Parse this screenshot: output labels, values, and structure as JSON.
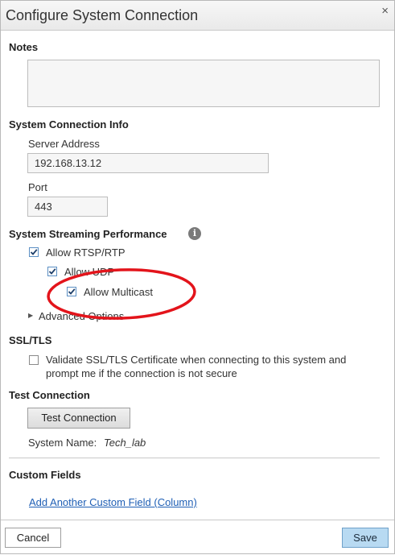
{
  "dialog": {
    "title": "Configure System Connection",
    "close_glyph": "×"
  },
  "notes": {
    "heading": "Notes",
    "value": ""
  },
  "connection_info": {
    "heading": "System Connection Info",
    "server_label": "Server Address",
    "server_value": "192.168.13.12",
    "port_label": "Port",
    "port_value": "443"
  },
  "streaming": {
    "heading": "System Streaming Performance",
    "info_icon": "i",
    "allow_rtsp_label": "Allow RTSP/RTP",
    "allow_rtsp_checked": true,
    "allow_udp_label": "Allow UDP",
    "allow_udp_checked": true,
    "allow_multicast_label": "Allow Multicast",
    "allow_multicast_checked": true,
    "advanced_label": "Advanced Options",
    "advanced_arrow": "▶"
  },
  "ssl": {
    "heading": "SSL/TLS",
    "validate_line1": "Validate SSL/TLS Certificate when connecting to this system and",
    "validate_line2": "prompt me if the connection is not secure",
    "validate_checked": false
  },
  "test_connection": {
    "heading": "Test Connection",
    "button_label": "Test Connection",
    "system_name_label": "System Name:",
    "system_name_value": "Tech_lab"
  },
  "custom_fields": {
    "heading": "Custom Fields",
    "add_link": "Add Another Custom Field (Column)"
  },
  "footer": {
    "cancel_label": "Cancel",
    "save_label": "Save"
  },
  "annotation": {
    "color": "#e3141b"
  }
}
